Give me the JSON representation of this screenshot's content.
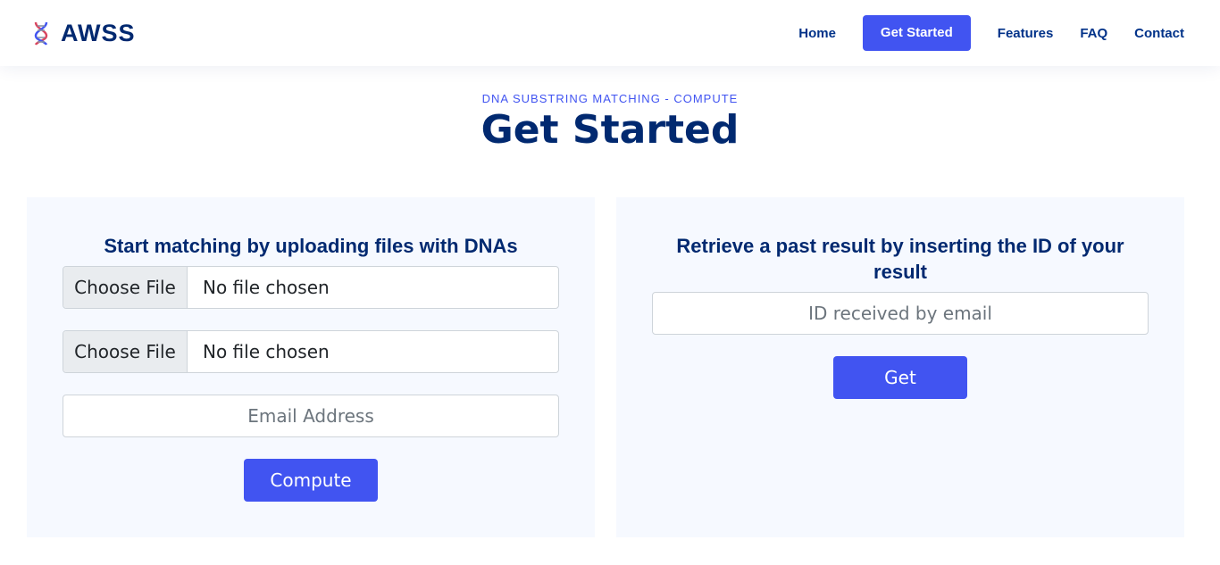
{
  "header": {
    "logo_text": "AWSS",
    "nav": [
      {
        "label": "Home"
      },
      {
        "label": "Get Started"
      },
      {
        "label": "Features"
      },
      {
        "label": "FAQ"
      },
      {
        "label": "Contact"
      }
    ]
  },
  "section": {
    "subtitle": "DNA SUBSTRING MATCHING - COMPUTE",
    "title": "Get Started"
  },
  "upload_card": {
    "heading": "Start matching by uploading files with DNAs",
    "file1": {
      "button": "Choose File",
      "status": "No file chosen"
    },
    "file2": {
      "button": "Choose File",
      "status": "No file chosen"
    },
    "email_placeholder": "Email Address",
    "compute_label": "Compute"
  },
  "retrieve_card": {
    "heading": "Retrieve a past result by inserting the ID of your result",
    "id_placeholder": "ID received by email",
    "get_label": "Get"
  },
  "colors": {
    "primary": "#4154f1",
    "heading": "#012970",
    "card_bg": "#f6f9ff"
  }
}
